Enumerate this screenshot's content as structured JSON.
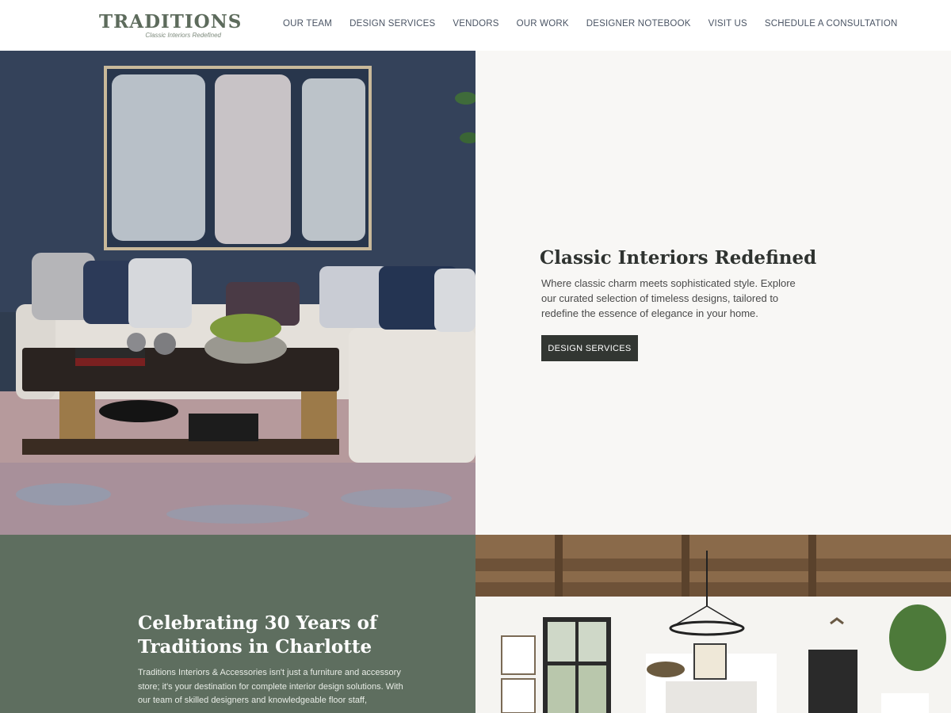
{
  "brand": {
    "title": "TRADITIONS",
    "tagline": "Classic Interiors Redefined"
  },
  "nav": {
    "items": [
      {
        "label": "OUR TEAM"
      },
      {
        "label": "DESIGN SERVICES"
      },
      {
        "label": "VENDORS"
      },
      {
        "label": "OUR WORK"
      },
      {
        "label": "DESIGNER NOTEBOOK"
      },
      {
        "label": "VISIT US"
      },
      {
        "label": "SCHEDULE A CONSULTATION"
      }
    ]
  },
  "hero": {
    "title": "Classic Interiors Redefined",
    "text": "Where classic charm meets sophisticated style. Explore our curated selection of timeless designs, tailored to redefine the essence of elegance in your home.",
    "button_label": "DESIGN SERVICES"
  },
  "about": {
    "title": "Celebrating 30 Years of Traditions in Charlotte",
    "text": "Traditions Interiors & Accessories isn't just a furniture and accessory store; it's your destination for complete interior design solutions. With our team of skilled designers and knowledgeable floor staff,"
  },
  "colors": {
    "brand_green": "#5d6b5c",
    "about_background": "#5e6e5f",
    "button_dark": "#323632",
    "hero_panel": "#f8f7f5"
  }
}
